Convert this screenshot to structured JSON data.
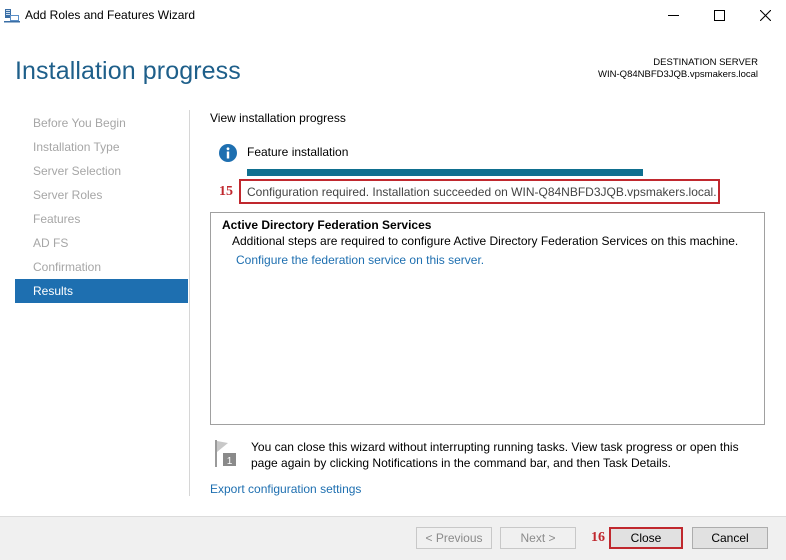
{
  "window": {
    "title": "Add Roles and Features Wizard",
    "icon": "server-manager-icon"
  },
  "header": {
    "page_title": "Installation progress",
    "destination_label": "DESTINATION SERVER",
    "destination_server": "WIN-Q84NBFD3JQB.vpsmakers.local"
  },
  "nav": {
    "items": [
      {
        "label": "Before You Begin",
        "active": false
      },
      {
        "label": "Installation Type",
        "active": false
      },
      {
        "label": "Server Selection",
        "active": false
      },
      {
        "label": "Server Roles",
        "active": false
      },
      {
        "label": "Features",
        "active": false
      },
      {
        "label": "AD FS",
        "active": false
      },
      {
        "label": "Confirmation",
        "active": false
      },
      {
        "label": "Results",
        "active": true
      }
    ]
  },
  "main": {
    "view_progress_label": "View installation progress",
    "feature_label": "Feature installation",
    "progress_value": 1.0,
    "status_text": "Configuration required. Installation succeeded on WIN-Q84NBFD3JQB.vpsmakers.local.",
    "result_heading": "Active Directory Federation Services",
    "result_description": "Additional steps are required to configure Active Directory Federation Services on this machine.",
    "result_link": "Configure the federation service on this server.",
    "note_text": "You can close this wizard without interrupting running tasks. View task progress or open this page again by clicking Notifications in the command bar, and then Task Details.",
    "export_link": "Export configuration settings"
  },
  "annotations": {
    "step_15": "15",
    "step_16": "16",
    "color": "#c0282e"
  },
  "footer": {
    "previous_label": "< Previous",
    "next_label": "Next >",
    "close_label": "Close",
    "cancel_label": "Cancel"
  },
  "colors": {
    "accent": "#1e6fb0",
    "title": "#1e5f8a",
    "progress": "#0f6f8f"
  }
}
